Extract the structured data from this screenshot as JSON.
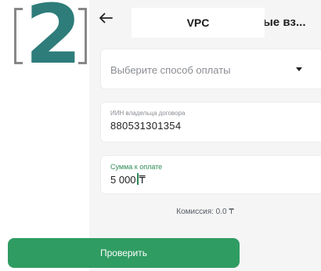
{
  "step": {
    "number": "2",
    "color": "#2e7d7a"
  },
  "header": {
    "title": "VPC",
    "behind_tab_text": "ые вз...",
    "back_icon": "arrow-left-icon"
  },
  "form": {
    "payment_method": {
      "placeholder": "Выберите способ оплаты",
      "icon": "caret-down-icon"
    },
    "iin": {
      "label": "ИИН владельца договора",
      "value": "880531301354"
    },
    "amount": {
      "label": "Сумма к оплате",
      "value_before_cursor": "5 000",
      "value_after_cursor": "₸",
      "accent": "#2e8b57"
    },
    "commission": "Комиссия: 0.0 ₸"
  },
  "actions": {
    "check_label": "Проверить",
    "button_color": "#2f9c62"
  }
}
